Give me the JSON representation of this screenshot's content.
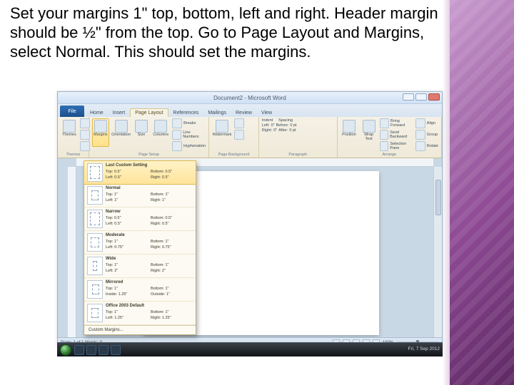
{
  "instruction": "Set your margins 1\" top, bottom, left and right. Header margin should be ½\" from the top. Go to Page Layout and Margins, select Normal. This should set the margins.",
  "window": {
    "title": "Document2 - Microsoft Word",
    "file_tab": "File"
  },
  "tabs": {
    "home": "Home",
    "insert": "Insert",
    "page_layout": "Page Layout",
    "references": "References",
    "mailings": "Mailings",
    "review": "Review",
    "view": "View"
  },
  "ribbon": {
    "themes": {
      "themes": "Themes",
      "group": "Themes"
    },
    "page_setup": {
      "margins": "Margins",
      "orientation": "Orientation",
      "size": "Size",
      "columns": "Columns",
      "breaks": "Breaks",
      "line_numbers": "Line Numbers",
      "hyphenation": "Hyphenation",
      "group": "Page Setup"
    },
    "page_bg": {
      "watermark": "Watermark",
      "page_color": "Page Color",
      "page_borders": "Page Borders",
      "group": "Page Background"
    },
    "paragraph": {
      "indent_label": "Indent",
      "spacing_label": "Spacing",
      "left": "Left:",
      "right": "Right:",
      "before": "Before:",
      "after": "After:",
      "left_v": "0\"",
      "right_v": "0\"",
      "before_v": "0 pt",
      "after_v": "0 pt",
      "group": "Paragraph"
    },
    "arrange": {
      "position": "Position",
      "wrap": "Wrap Text",
      "forward": "Bring Forward",
      "backward": "Send Backward",
      "selection": "Selection Pane",
      "align": "Align",
      "group_btn": "Group",
      "rotate": "Rotate",
      "group": "Arrange"
    }
  },
  "margins_menu": {
    "last": {
      "name": "Last Custom Setting",
      "top": "Top: 0.5\"",
      "bottom": "Bottom: 0.5\"",
      "left": "Left: 0.5\"",
      "right": "Right: 0.5\""
    },
    "normal": {
      "name": "Normal",
      "top": "Top: 1\"",
      "bottom": "Bottom: 1\"",
      "left": "Left: 1\"",
      "right": "Right: 1\""
    },
    "narrow": {
      "name": "Narrow",
      "top": "Top: 0.5\"",
      "bottom": "Bottom: 0.5\"",
      "left": "Left: 0.5\"",
      "right": "Right: 0.5\""
    },
    "moderate": {
      "name": "Moderate",
      "top": "Top: 1\"",
      "bottom": "Bottom: 1\"",
      "left": "Left: 0.75\"",
      "right": "Right: 0.75\""
    },
    "wide": {
      "name": "Wide",
      "top": "Top: 1\"",
      "bottom": "Bottom: 1\"",
      "left": "Left: 2\"",
      "right": "Right: 2\""
    },
    "mirrored": {
      "name": "Mirrored",
      "top": "Top: 1\"",
      "bottom": "Bottom: 1\"",
      "left": "Inside: 1.25\"",
      "right": "Outside: 1\""
    },
    "o2003": {
      "name": "Office 2003 Default",
      "top": "Top: 1\"",
      "bottom": "Bottom: 1\"",
      "left": "Left: 1.25\"",
      "right": "Right: 1.25\""
    },
    "custom": "Custom Margins..."
  },
  "status": {
    "left": "Page: 1 of 1   Words: 0",
    "zoom": "100%"
  },
  "taskbar": {
    "clock": "Fri, 7 Sep 2012"
  }
}
